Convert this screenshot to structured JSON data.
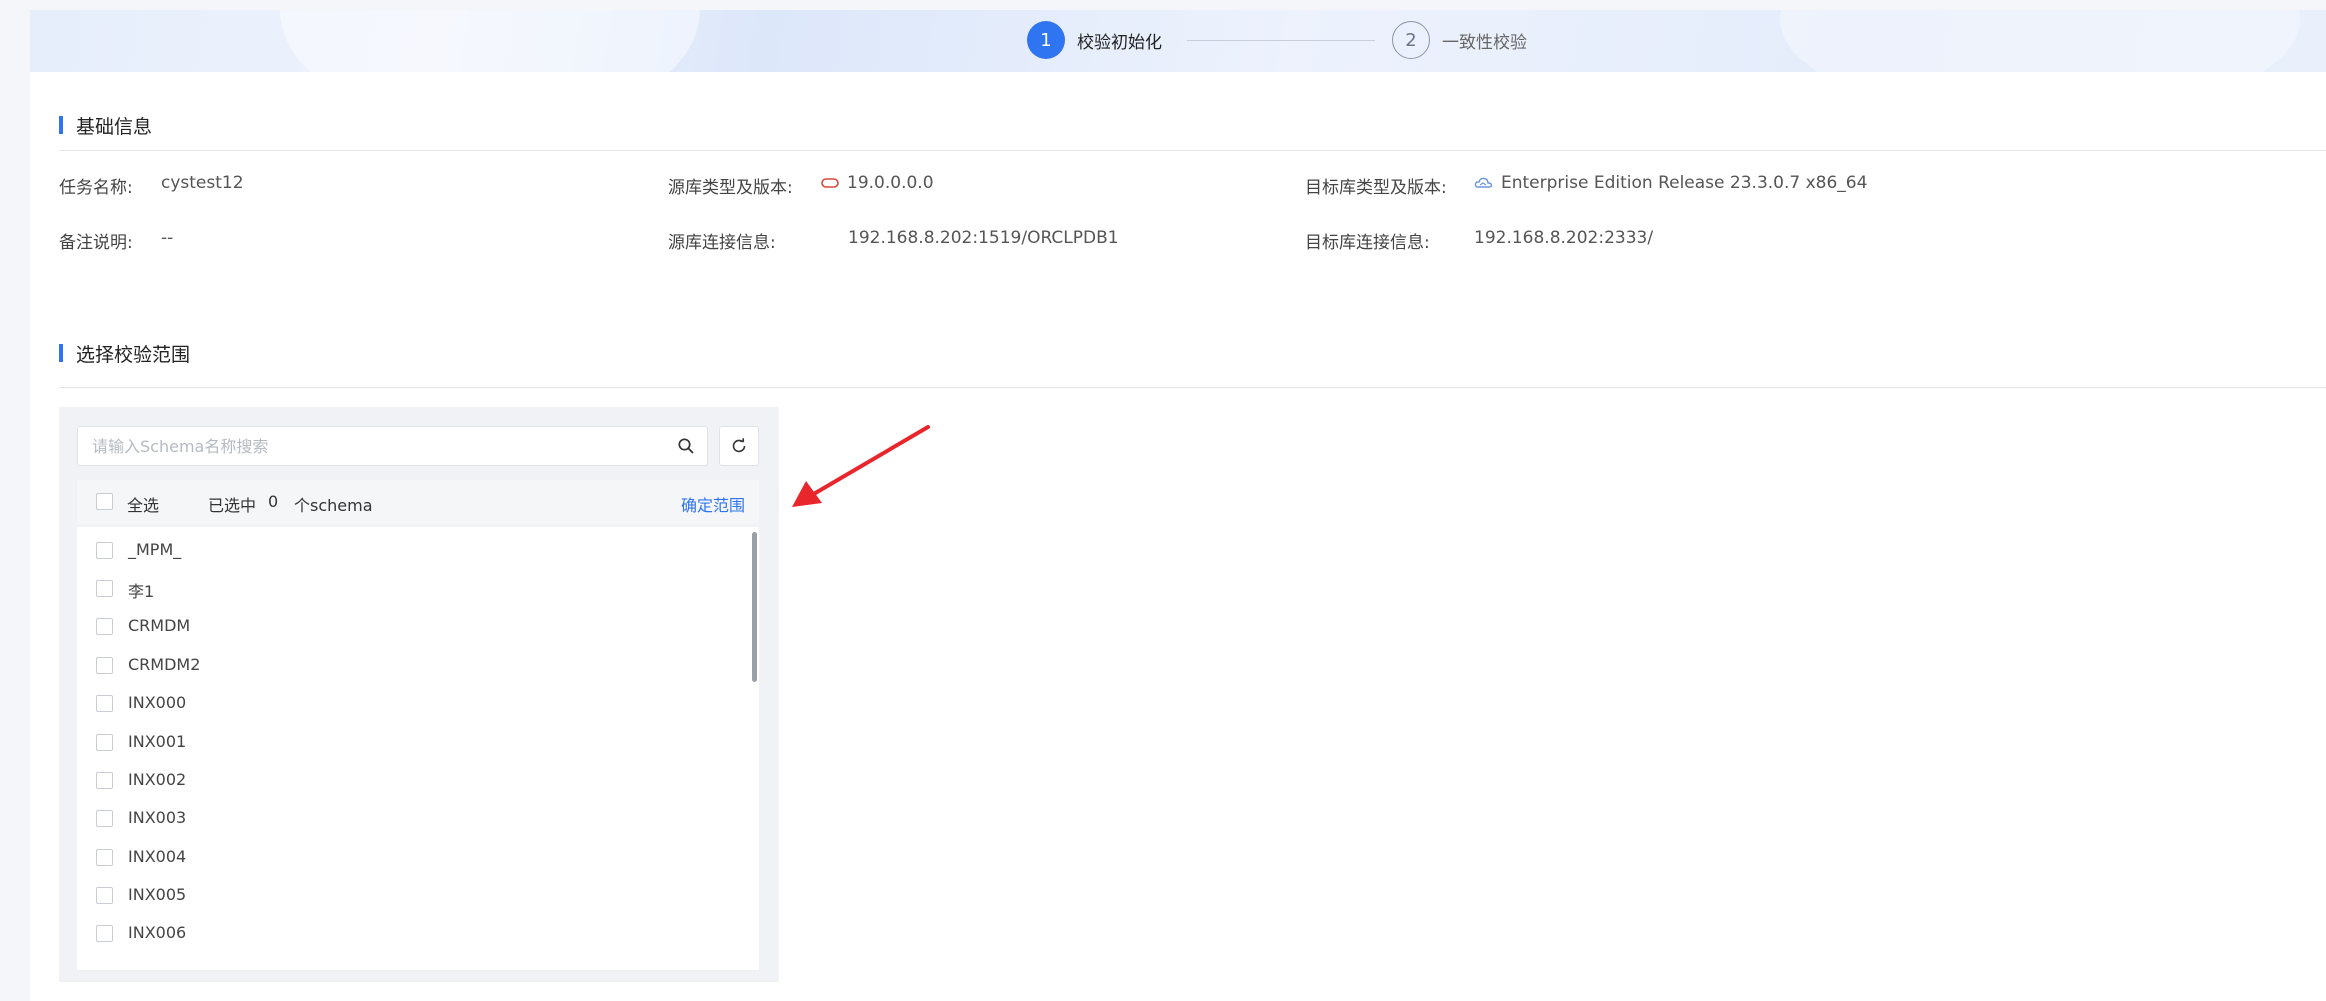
{
  "steps": [
    {
      "number": "1",
      "label": "校验初始化",
      "state": "active"
    },
    {
      "number": "2",
      "label": "一致性校验",
      "state": "inactive"
    }
  ],
  "basic_info": {
    "title": "基础信息",
    "task_name_label": "任务名称:",
    "task_name_value": "cystest12",
    "remark_label": "备注说明:",
    "remark_value": "--",
    "source_type_label": "源库类型及版本:",
    "source_type_value": "19.0.0.0.0",
    "source_icon": "oracle-db-icon",
    "source_conn_label": "源库连接信息:",
    "source_conn_value": "192.168.8.202:1519/ORCLPDB1",
    "target_type_label": "目标库类型及版本:",
    "target_type_value": "Enterprise Edition Release 23.3.0.7 x86_64",
    "target_icon": "cloud-db-icon",
    "target_conn_label": "目标库连接信息:",
    "target_conn_value": "192.168.8.202:2333/"
  },
  "scope": {
    "title": "选择校验范围",
    "search_placeholder": "请输入Schema名称搜索",
    "select_all_label": "全选",
    "selected_prefix": "已选中",
    "selected_count": "0",
    "selected_suffix": "个schema",
    "confirm_label": "确定范围",
    "items": [
      "_MPM_",
      "李1",
      "CRMDM",
      "CRMDM2",
      "INX000",
      "INX001",
      "INX002",
      "INX003",
      "INX004",
      "INX005",
      "INX006"
    ]
  },
  "colors": {
    "accent": "#2f74f0",
    "annotation_arrow": "#e8262c",
    "oracle_icon": "#d9483b"
  }
}
